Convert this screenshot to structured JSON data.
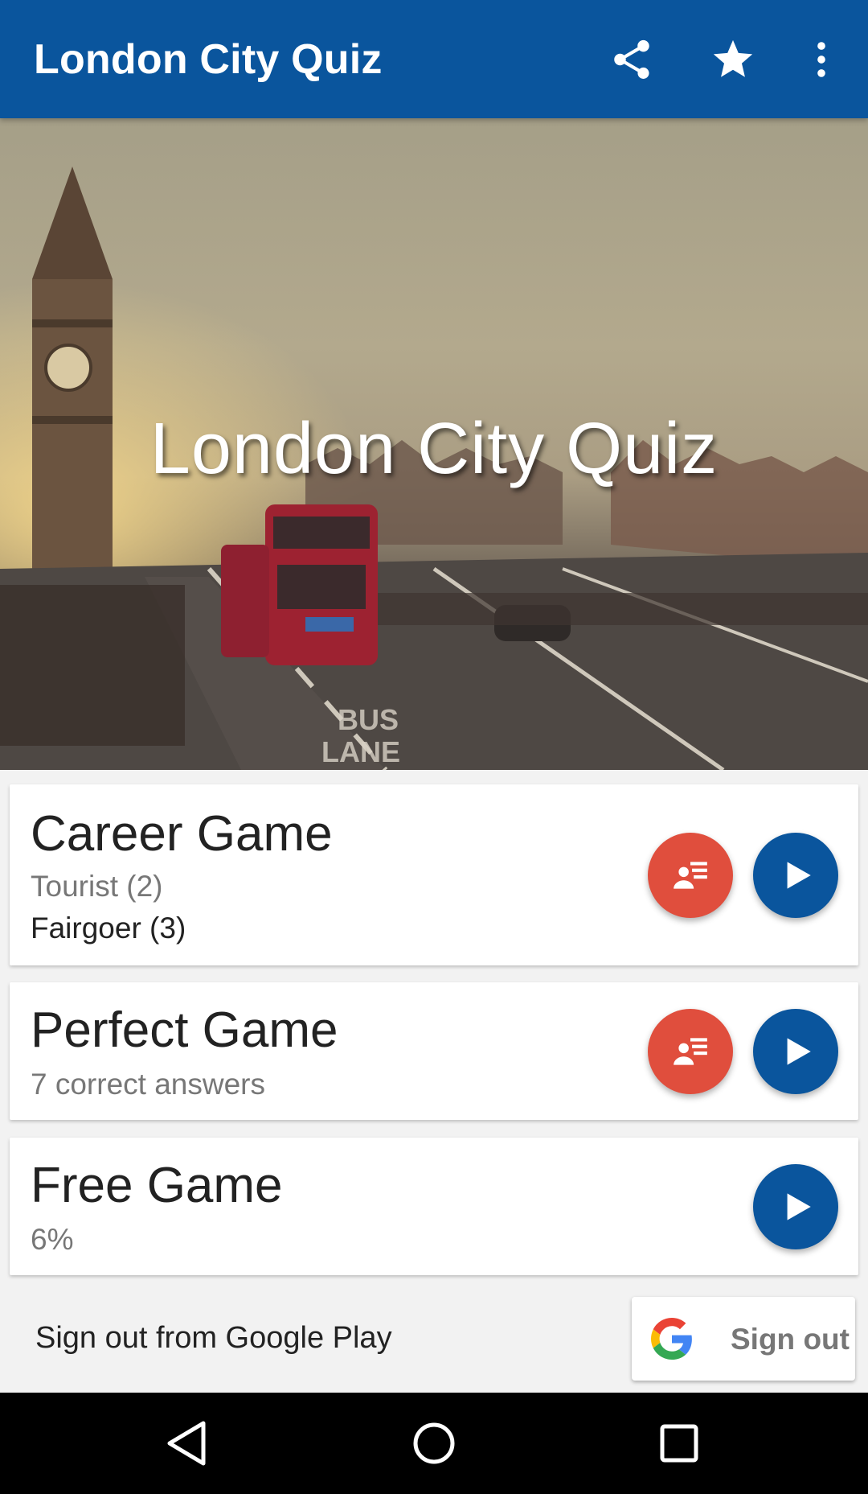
{
  "appbar": {
    "title": "London City Quiz",
    "share_icon": "share-icon",
    "star_icon": "star-icon",
    "more_icon": "more-vert-icon",
    "color": "#0a559d"
  },
  "hero": {
    "title": "London City Quiz",
    "image": "london-westminster-bridge-photo"
  },
  "cards": {
    "career": {
      "title": "Career Game",
      "line1": "Tourist (2)",
      "line2": "Fairgoer (3)"
    },
    "perfect": {
      "title": "Perfect Game",
      "line1": "7 correct answers"
    },
    "free": {
      "title": "Free Game",
      "line1": "6%"
    }
  },
  "colors": {
    "leaderboard_fab": "#e04e3d",
    "play_fab": "#0a559d"
  },
  "signout": {
    "label": "Sign out from Google Play",
    "button_label": "Sign out"
  },
  "navbar": {
    "back_icon": "back-triangle-icon",
    "home_icon": "home-circle-icon",
    "recent_icon": "recents-square-icon"
  }
}
